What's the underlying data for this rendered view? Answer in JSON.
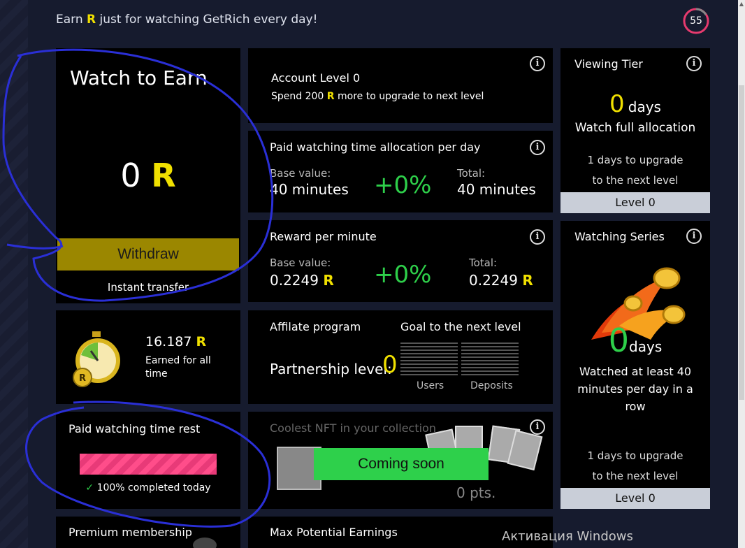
{
  "topbar": {
    "text_before": "Earn",
    "coin_glyph": "R",
    "text_after": "just for watching GetRich every day!",
    "timer_value": "55"
  },
  "watch_to_earn": {
    "title": "Watch to Earn",
    "amount": "0",
    "withdraw_label": "Withdraw",
    "instant_label": "Instant transfer"
  },
  "account_level": {
    "title": "Account Level 0",
    "subtitle_before": "Spend 200",
    "subtitle_after": "more to upgrade to next level"
  },
  "allocation": {
    "title": "Paid watching time allocation per day",
    "base_label": "Base value:",
    "base_value": "40 minutes",
    "bonus": "+0%",
    "total_label": "Total:",
    "total_value": "40 minutes"
  },
  "reward": {
    "title": "Reward per minute",
    "base_label": "Base value:",
    "base_value": "0.2249",
    "bonus": "+0%",
    "total_label": "Total:",
    "total_value": "0.2249"
  },
  "viewing_tier": {
    "title": "Viewing Tier",
    "days_value": "0",
    "days_unit": "days",
    "subtitle": "Watch full allocation",
    "upgrade_line1": "1 days to upgrade",
    "upgrade_line2": "to the next level",
    "level": "Level 0"
  },
  "earned": {
    "amount": "16.187",
    "label": "Earned for all time"
  },
  "affiliate": {
    "title": "Affilate program",
    "goal_title": "Goal to the next level",
    "level_label": "Partnership level:",
    "level_value": "0",
    "col_users": "Users",
    "col_deposits": "Deposits"
  },
  "watching_series": {
    "title": "Watching Series",
    "days_value": "0",
    "days_unit": "days",
    "description": "Watched at least 40 minutes per day in a row",
    "upgrade_line1": "1 days to upgrade",
    "upgrade_line2": "to the next level",
    "level": "Level 0"
  },
  "paid_rest": {
    "title": "Paid watching time rest",
    "progress": 1.0,
    "status_check": "✓",
    "status": "100% completed today"
  },
  "nft": {
    "title": "Coolest NFT in your collection",
    "coming_soon": "Coming soon",
    "points": "0 pts."
  },
  "premium": {
    "title": "Premium membership"
  },
  "max_earnings": {
    "title": "Max Potential Earnings"
  },
  "windows": {
    "activation": "Активация Windows"
  },
  "colors": {
    "accent_yellow": "#f0e000",
    "positive_green": "#2ecf4a",
    "withdraw_gold": "#9b8700",
    "progress_pink": "#ff4d8a",
    "annotation_blue": "#2a2fd6"
  }
}
